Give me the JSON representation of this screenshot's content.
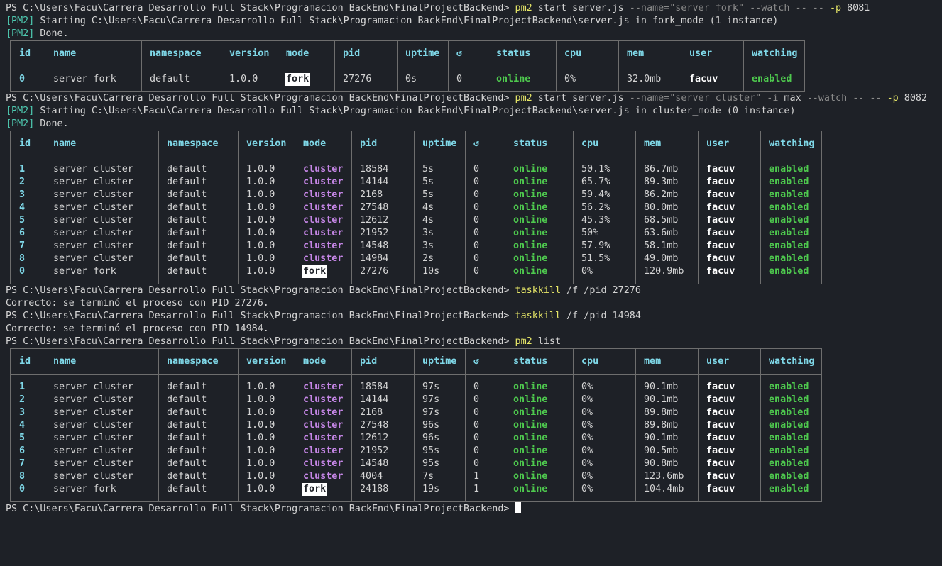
{
  "prompt": "PS C:\\Users\\Facu\\Carrera Desarrollo Full Stack\\Programacion BackEnd\\FinalProjectBackend>",
  "cmd1": {
    "cmd": "pm2",
    "args1": "start server.js",
    "args2": "--name=\"server fork\" --watch -- --",
    "flag": "-p",
    "port": "8081",
    "out1_tag": "[PM2]",
    "out1": " Starting C:\\Users\\Facu\\Carrera Desarrollo Full Stack\\Programacion BackEnd\\FinalProjectBackend\\server.js in fork_mode (1 instance)",
    "out2_tag": "[PM2]",
    "out2": " Done."
  },
  "cmd2": {
    "cmd": "pm2",
    "args1": "start server.js",
    "args2": "--name=\"server cluster\"",
    "args3": "-i",
    "args4": "max",
    "args5": "--watch -- --",
    "flag": "-p",
    "port": "8082",
    "out1_tag": "[PM2]",
    "out1": " Starting C:\\Users\\Facu\\Carrera Desarrollo Full Stack\\Programacion BackEnd\\FinalProjectBackend\\server.js in cluster_mode (0 instance)",
    "out2_tag": "[PM2]",
    "out2": " Done."
  },
  "cmd3": {
    "cmd": "taskkill",
    "args": " /f /pid 27276",
    "out": "Correcto: se terminó el proceso con PID 27276."
  },
  "cmd4": {
    "cmd": "taskkill",
    "args": " /f /pid 14984",
    "out": "Correcto: se terminó el proceso con PID 14984."
  },
  "cmd5": {
    "cmd": "pm2",
    "args": " list"
  },
  "headers": [
    "id",
    "name",
    "namespace",
    "version",
    "mode",
    "pid",
    "uptime",
    "↺",
    "status",
    "cpu",
    "mem",
    "user",
    "watching"
  ],
  "table1": [
    [
      "0",
      "server fork",
      "default",
      "1.0.0",
      "fork",
      "27276",
      "0s",
      "0",
      "online",
      "0%",
      "32.0mb",
      "facuv",
      "enabled"
    ]
  ],
  "table2": [
    [
      "1",
      "server cluster",
      "default",
      "1.0.0",
      "cluster",
      "18584",
      "5s",
      "0",
      "online",
      "50.1%",
      "86.7mb",
      "facuv",
      "enabled"
    ],
    [
      "2",
      "server cluster",
      "default",
      "1.0.0",
      "cluster",
      "14144",
      "5s",
      "0",
      "online",
      "65.7%",
      "89.3mb",
      "facuv",
      "enabled"
    ],
    [
      "3",
      "server cluster",
      "default",
      "1.0.0",
      "cluster",
      "2168",
      "5s",
      "0",
      "online",
      "59.4%",
      "86.2mb",
      "facuv",
      "enabled"
    ],
    [
      "4",
      "server cluster",
      "default",
      "1.0.0",
      "cluster",
      "27548",
      "4s",
      "0",
      "online",
      "56.2%",
      "80.0mb",
      "facuv",
      "enabled"
    ],
    [
      "5",
      "server cluster",
      "default",
      "1.0.0",
      "cluster",
      "12612",
      "4s",
      "0",
      "online",
      "45.3%",
      "68.5mb",
      "facuv",
      "enabled"
    ],
    [
      "6",
      "server cluster",
      "default",
      "1.0.0",
      "cluster",
      "21952",
      "3s",
      "0",
      "online",
      "50%",
      "63.6mb",
      "facuv",
      "enabled"
    ],
    [
      "7",
      "server cluster",
      "default",
      "1.0.0",
      "cluster",
      "14548",
      "3s",
      "0",
      "online",
      "57.9%",
      "58.1mb",
      "facuv",
      "enabled"
    ],
    [
      "8",
      "server cluster",
      "default",
      "1.0.0",
      "cluster",
      "14984",
      "2s",
      "0",
      "online",
      "51.5%",
      "49.0mb",
      "facuv",
      "enabled"
    ],
    [
      "0",
      "server fork",
      "default",
      "1.0.0",
      "fork",
      "27276",
      "10s",
      "0",
      "online",
      "0%",
      "120.9mb",
      "facuv",
      "enabled"
    ]
  ],
  "table3": [
    [
      "1",
      "server cluster",
      "default",
      "1.0.0",
      "cluster",
      "18584",
      "97s",
      "0",
      "online",
      "0%",
      "90.1mb",
      "facuv",
      "enabled"
    ],
    [
      "2",
      "server cluster",
      "default",
      "1.0.0",
      "cluster",
      "14144",
      "97s",
      "0",
      "online",
      "0%",
      "90.1mb",
      "facuv",
      "enabled"
    ],
    [
      "3",
      "server cluster",
      "default",
      "1.0.0",
      "cluster",
      "2168",
      "97s",
      "0",
      "online",
      "0%",
      "89.8mb",
      "facuv",
      "enabled"
    ],
    [
      "4",
      "server cluster",
      "default",
      "1.0.0",
      "cluster",
      "27548",
      "96s",
      "0",
      "online",
      "0%",
      "89.8mb",
      "facuv",
      "enabled"
    ],
    [
      "5",
      "server cluster",
      "default",
      "1.0.0",
      "cluster",
      "12612",
      "96s",
      "0",
      "online",
      "0%",
      "90.1mb",
      "facuv",
      "enabled"
    ],
    [
      "6",
      "server cluster",
      "default",
      "1.0.0",
      "cluster",
      "21952",
      "95s",
      "0",
      "online",
      "0%",
      "90.5mb",
      "facuv",
      "enabled"
    ],
    [
      "7",
      "server cluster",
      "default",
      "1.0.0",
      "cluster",
      "14548",
      "95s",
      "0",
      "online",
      "0%",
      "90.8mb",
      "facuv",
      "enabled"
    ],
    [
      "8",
      "server cluster",
      "default",
      "1.0.0",
      "cluster",
      "4004",
      "7s",
      "1",
      "online",
      "0%",
      "123.6mb",
      "facuv",
      "enabled"
    ],
    [
      "0",
      "server fork",
      "default",
      "1.0.0",
      "fork",
      "24188",
      "19s",
      "1",
      "online",
      "0%",
      "104.4mb",
      "facuv",
      "enabled"
    ]
  ]
}
